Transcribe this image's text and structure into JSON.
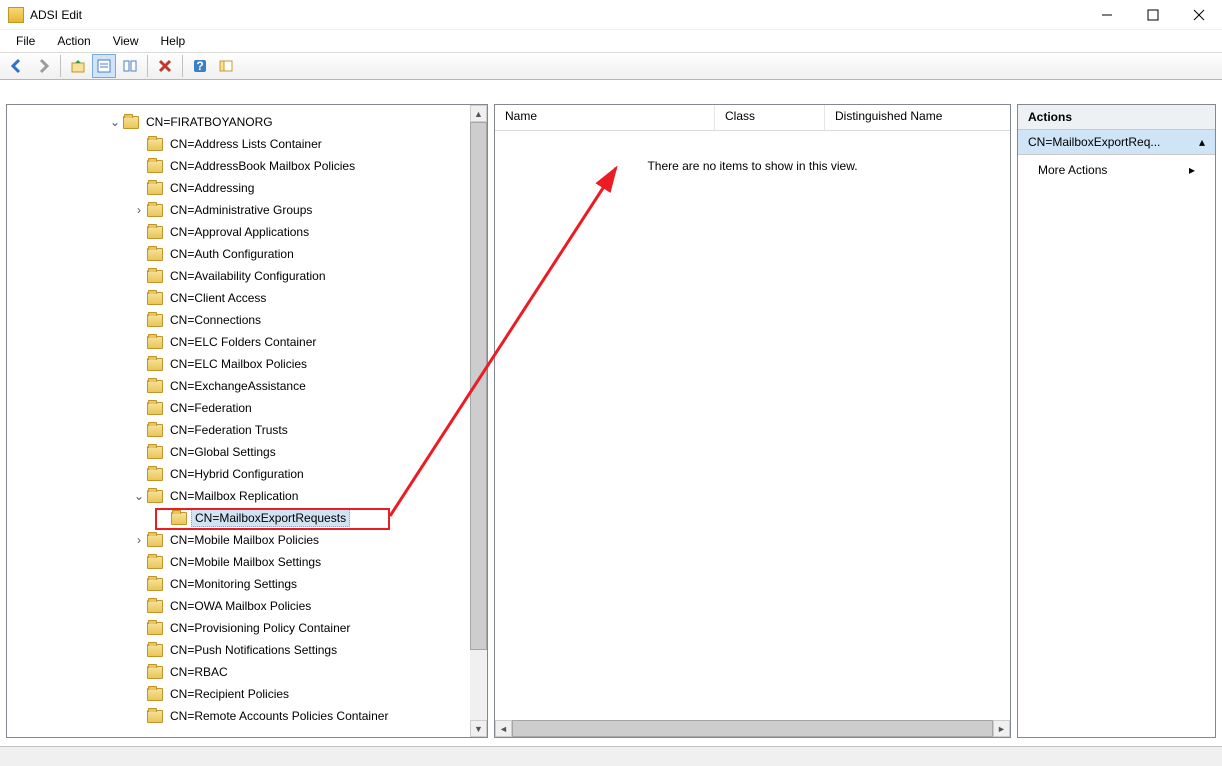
{
  "window": {
    "title": "ADSI Edit"
  },
  "menu": {
    "file": "File",
    "action": "Action",
    "view": "View",
    "help": "Help"
  },
  "toolbar": {
    "back": "back",
    "forward": "forward",
    "up": "up",
    "props": "properties",
    "delete": "delete",
    "help": "help",
    "showhide": "showhide"
  },
  "tree": {
    "root": "CN=FIRATBOYANORG",
    "items": [
      {
        "label": "CN=Address Lists Container",
        "indent": 2
      },
      {
        "label": "CN=AddressBook Mailbox Policies",
        "indent": 2
      },
      {
        "label": "CN=Addressing",
        "indent": 2
      },
      {
        "label": "CN=Administrative Groups",
        "indent": 2,
        "exp": ">"
      },
      {
        "label": "CN=Approval Applications",
        "indent": 2
      },
      {
        "label": "CN=Auth Configuration",
        "indent": 2
      },
      {
        "label": "CN=Availability Configuration",
        "indent": 2
      },
      {
        "label": "CN=Client Access",
        "indent": 2
      },
      {
        "label": "CN=Connections",
        "indent": 2
      },
      {
        "label": "CN=ELC Folders Container",
        "indent": 2
      },
      {
        "label": "CN=ELC Mailbox Policies",
        "indent": 2
      },
      {
        "label": "CN=ExchangeAssistance",
        "indent": 2
      },
      {
        "label": "CN=Federation",
        "indent": 2
      },
      {
        "label": "CN=Federation Trusts",
        "indent": 2
      },
      {
        "label": "CN=Global Settings",
        "indent": 2
      },
      {
        "label": "CN=Hybrid Configuration",
        "indent": 2
      },
      {
        "label": "CN=Mailbox Replication",
        "indent": 2,
        "exp": "v"
      },
      {
        "label": "CN=MailboxExportRequests",
        "indent": 3,
        "selected": true
      },
      {
        "label": "CN=Mobile Mailbox Policies",
        "indent": 2,
        "exp": ">"
      },
      {
        "label": "CN=Mobile Mailbox Settings",
        "indent": 2
      },
      {
        "label": "CN=Monitoring Settings",
        "indent": 2
      },
      {
        "label": "CN=OWA Mailbox Policies",
        "indent": 2
      },
      {
        "label": "CN=Provisioning Policy Container",
        "indent": 2
      },
      {
        "label": "CN=Push Notifications Settings",
        "indent": 2
      },
      {
        "label": "CN=RBAC",
        "indent": 2
      },
      {
        "label": "CN=Recipient Policies",
        "indent": 2
      },
      {
        "label": "CN=Remote Accounts Policies Container",
        "indent": 2
      }
    ]
  },
  "list": {
    "columns": {
      "name": "Name",
      "class": "Class",
      "dn": "Distinguished Name"
    },
    "empty": "There are no items to show in this view."
  },
  "actions": {
    "header": "Actions",
    "selected": "CN=MailboxExportReq...",
    "more": "More Actions"
  }
}
